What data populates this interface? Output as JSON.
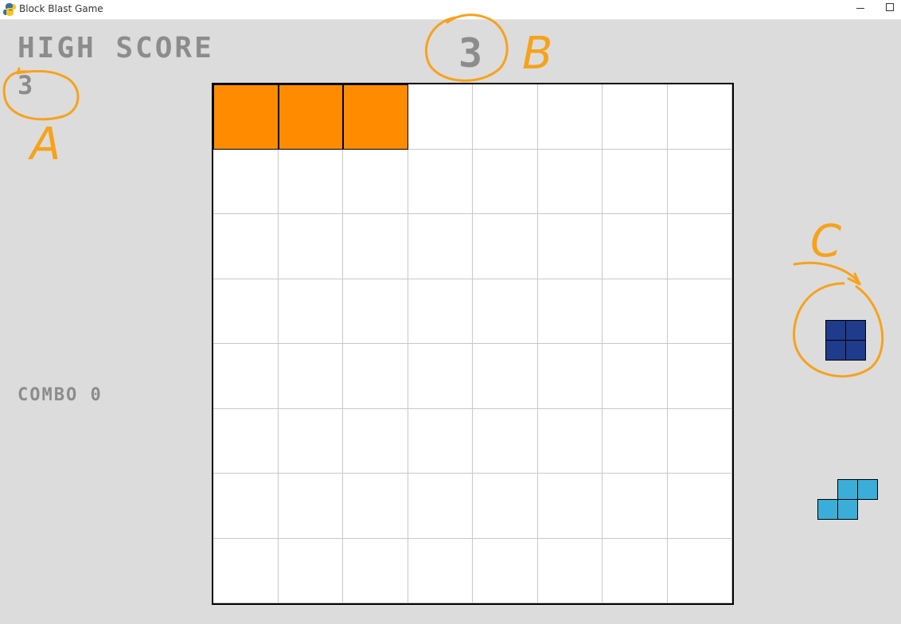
{
  "window": {
    "title": "Block Blast Game",
    "icon": "python-snake-icon"
  },
  "hud": {
    "high_score_label": "HIGH SCORE",
    "high_score_value": "3",
    "score_value": "3",
    "combo_text": "COMBO 0"
  },
  "annotations": {
    "label_a": "A",
    "label_b": "B",
    "label_c": "C",
    "color": "#f7a21b"
  },
  "board": {
    "rows": 8,
    "cols": 8,
    "empty_color": "#ffffff",
    "grid_color": "#c8c8c8",
    "filled_cells": [
      {
        "row": 0,
        "col": 0,
        "color": "#ff8c00"
      },
      {
        "row": 0,
        "col": 1,
        "color": "#ff8c00"
      },
      {
        "row": 0,
        "col": 2,
        "color": "#ff8c00"
      }
    ]
  },
  "tray": {
    "pieces": [
      {
        "name": "square-2x2",
        "color": "#1f3b8c",
        "cells": [
          [
            0,
            0
          ],
          [
            0,
            1
          ],
          [
            1,
            0
          ],
          [
            1,
            1
          ]
        ]
      },
      {
        "name": "s-piece",
        "color": "#3aaed8",
        "cells": [
          [
            0,
            1
          ],
          [
            0,
            2
          ],
          [
            1,
            0
          ],
          [
            1,
            1
          ]
        ]
      }
    ]
  }
}
